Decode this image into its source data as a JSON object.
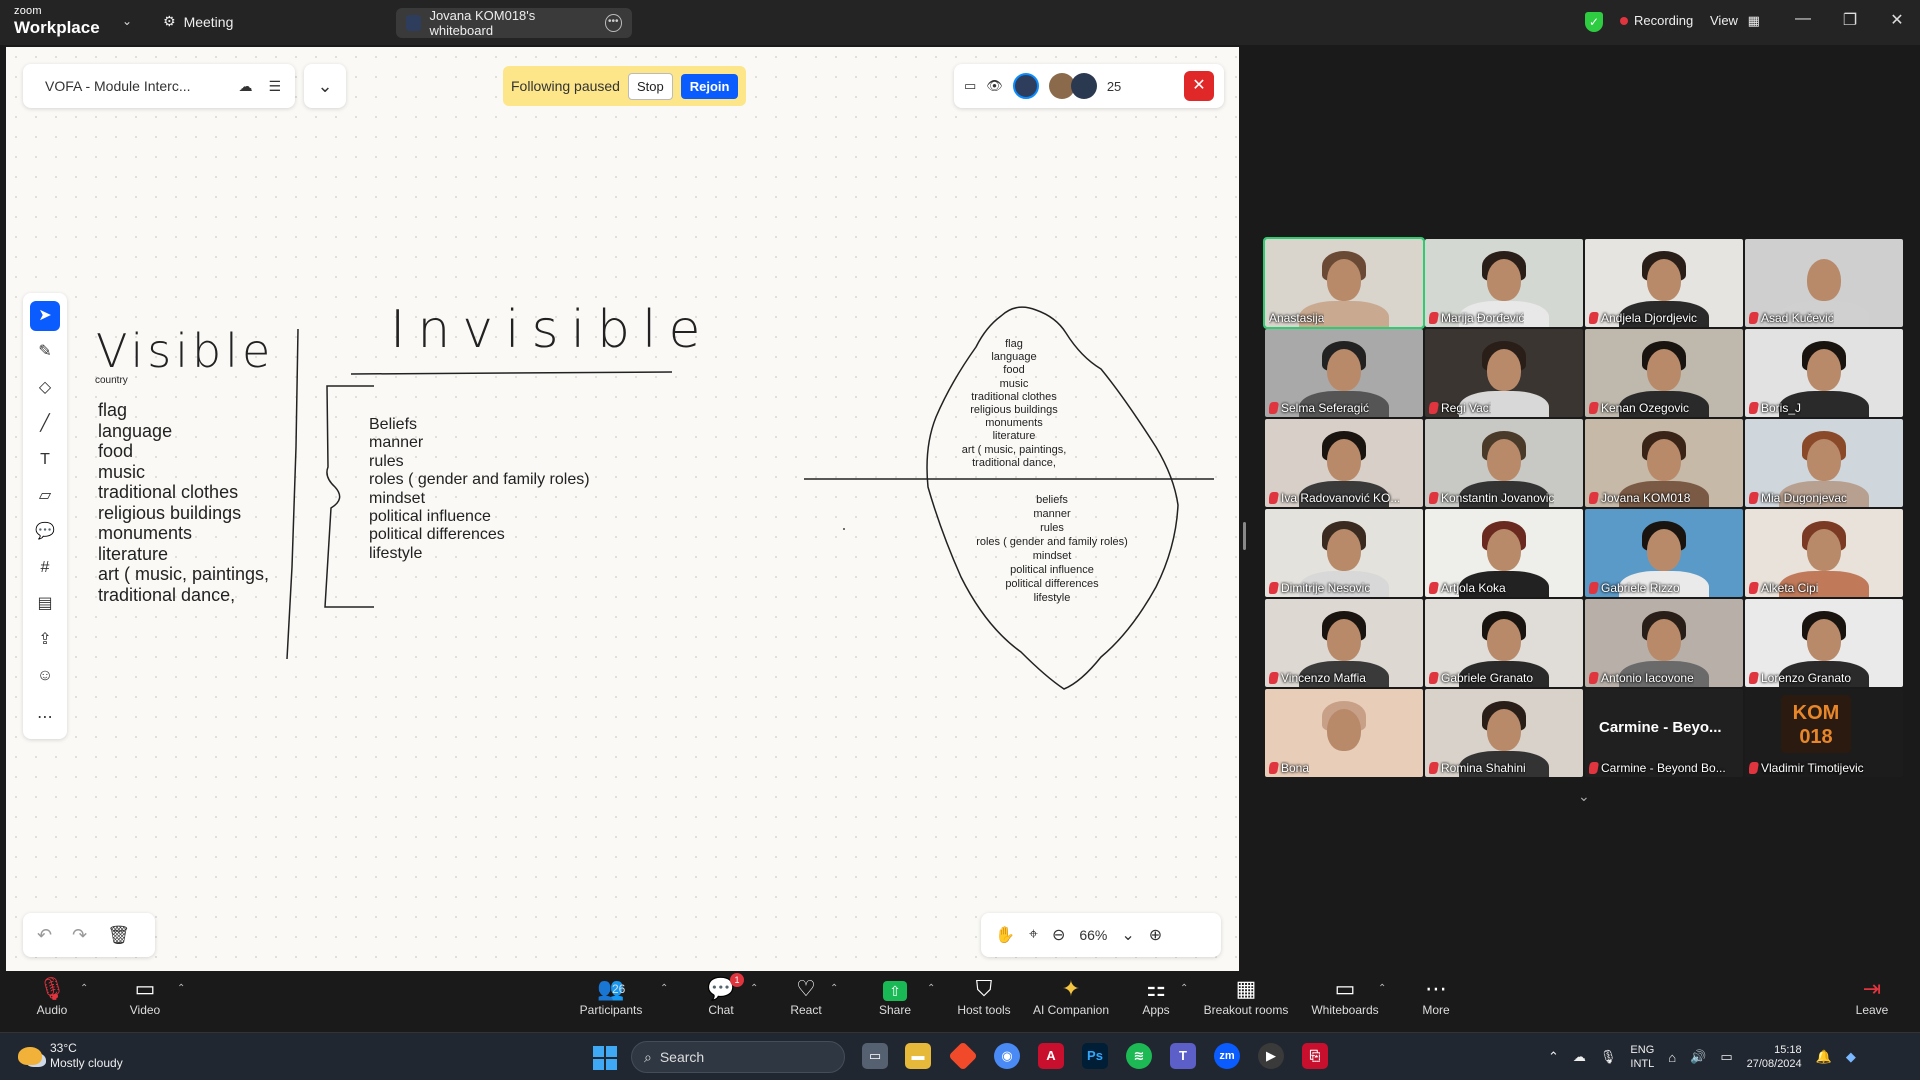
{
  "titlebar": {
    "brand_top": "zoom",
    "brand_bottom": "Workplace",
    "meeting_label": "Meeting",
    "tab_title": "Jovana KOM018's whiteboard",
    "recording_label": "Recording",
    "view_label": "View"
  },
  "whiteboard": {
    "file_name": "VOFA - Module Interc...",
    "following_text": "Following paused",
    "stop_label": "Stop",
    "rejoin_label": "Rejoin",
    "collaborator_count": "25",
    "zoom_level": "66%",
    "visible_title": "Visible",
    "invisible_title": "Invisible",
    "country_label": "country",
    "visible_items": [
      "flag",
      "language",
      "food",
      "music",
      "traditional clothes",
      "religious buildings",
      "monuments",
      "literature",
      "art ( music, paintings,",
      "traditional dance,"
    ],
    "invisible_items": [
      "Beliefs",
      "manner",
      "rules",
      "roles ( gender and family roles)",
      "mindset",
      "political influence",
      "political differences",
      "lifestyle"
    ],
    "iceberg_top_items": [
      "flag",
      "language",
      "food",
      "music",
      "traditional clothes",
      "religious buildings",
      "monuments",
      "literature",
      "art ( music, paintings,",
      "traditional dance,"
    ],
    "iceberg_bottom_items": [
      "beliefs",
      "manner",
      "rules",
      "roles ( gender and family roles)",
      "mindset",
      "political influence",
      "political differences",
      "lifestyle"
    ]
  },
  "gallery": {
    "participants": [
      {
        "name": "Anastasija",
        "muted": false,
        "active": true,
        "bg": "#d9d4cc",
        "shirt": "#c9a98f",
        "hair": "#6a4a35"
      },
      {
        "name": "Marija Đorđević",
        "muted": true,
        "bg": "#d4d8d2",
        "shirt": "#e8e8e8",
        "hair": "#2a1e18"
      },
      {
        "name": "Andjela Djordjevic",
        "muted": true,
        "bg": "#e6e4e0",
        "shirt": "#2a2a2a",
        "hair": "#2a1e18"
      },
      {
        "name": "Asad Kučević",
        "muted": true,
        "bg": "#cfcfcf",
        "shirt": "#d0d0d0",
        "hair": "#cfcfcf"
      },
      {
        "name": "Selma Seferagić",
        "muted": true,
        "bg": "#a9a9a9",
        "shirt": "#555",
        "hair": "#222"
      },
      {
        "name": "Regi Vaci",
        "muted": true,
        "bg": "#3a3530",
        "shirt": "#d8d8d8",
        "hair": "#2a1e18"
      },
      {
        "name": "Kenan Ozegovic",
        "muted": true,
        "bg": "#bfb8ac",
        "shirt": "#2a2a2a",
        "hair": "#1a1410"
      },
      {
        "name": "Boris_J",
        "muted": true,
        "bg": "#e2e2e2",
        "shirt": "#2a2a2a",
        "hair": "#1a1410"
      },
      {
        "name": "Iva Radovanović KO...",
        "muted": true,
        "bg": "#d8d0c8",
        "shirt": "#3a3a3a",
        "hair": "#1a1410"
      },
      {
        "name": "Konstantin Jovanovic",
        "muted": true,
        "bg": "#c8c8c4",
        "shirt": "#333",
        "hair": "#4a3a2a"
      },
      {
        "name": "Jovana KOM018",
        "muted": true,
        "bg": "#c6b9a8",
        "shirt": "#7a5a44",
        "hair": "#3a2418"
      },
      {
        "name": "Mia Dugonjevac",
        "muted": true,
        "bg": "#cfd6dc",
        "shirt": "#b8a090",
        "hair": "#8a4a2a"
      },
      {
        "name": "Dimitrije Nesovic",
        "muted": true,
        "bg": "#e4e2dc",
        "shirt": "#d8d8d8",
        "hair": "#3a2a20"
      },
      {
        "name": "Artjola Koka",
        "muted": true,
        "bg": "#eeeeea",
        "shirt": "#222",
        "hair": "#6a2a20"
      },
      {
        "name": "Gabriele Rizzo",
        "muted": true,
        "bg": "#5a9ac8",
        "shirt": "#eaeaea",
        "hair": "#1a1410"
      },
      {
        "name": "Alketa Cipi",
        "muted": true,
        "bg": "#e8e2da",
        "shirt": "#c07a5a",
        "hair": "#7a3a24"
      },
      {
        "name": "Vincenzo Maffia",
        "muted": true,
        "bg": "#ddd8d2",
        "shirt": "#3a3a3a",
        "hair": "#1a1410"
      },
      {
        "name": "Gabriele Granato",
        "muted": true,
        "bg": "#e0ddd8",
        "shirt": "#2a2a2a",
        "hair": "#1a1410"
      },
      {
        "name": "Antonio Iacovone",
        "muted": true,
        "bg": "#b8b0a8",
        "shirt": "#6a6a6a",
        "hair": "#2a1e18"
      },
      {
        "name": "Lorenzo Granato",
        "muted": true,
        "bg": "#eaeaea",
        "shirt": "#2a2a2a",
        "hair": "#1a1410"
      },
      {
        "name": "Bona",
        "muted": true,
        "bg": "#e8cdb8",
        "shirt": "#e8cdb8",
        "hair": "#c8a088"
      },
      {
        "name": "Romina Shahini",
        "muted": true,
        "bg": "#d8d2ca",
        "shirt": "#333",
        "hair": "#2a1e18"
      },
      {
        "name": "Carmine - Beyond Bo...",
        "muted": true,
        "text_tile": true,
        "big": "Carmine - Beyo..."
      },
      {
        "name": "Vladimir Timotijevic",
        "muted": true,
        "logo": true,
        "logo_top": "KOM",
        "logo_bottom": "018"
      }
    ]
  },
  "controls": {
    "audio": "Audio",
    "video": "Video",
    "participants": "Participants",
    "participant_count": "26",
    "chat": "Chat",
    "chat_badge": "1",
    "react": "React",
    "share": "Share",
    "host_tools": "Host tools",
    "ai_companion": "AI Companion",
    "apps": "Apps",
    "breakout": "Breakout rooms",
    "whiteboards": "Whiteboards",
    "more": "More",
    "leave": "Leave"
  },
  "taskbar": {
    "temperature": "33°C",
    "weather": "Mostly cloudy",
    "search": "Search",
    "lang_top": "ENG",
    "lang_bottom": "INTL",
    "time": "15:18",
    "date": "27/08/2024"
  }
}
